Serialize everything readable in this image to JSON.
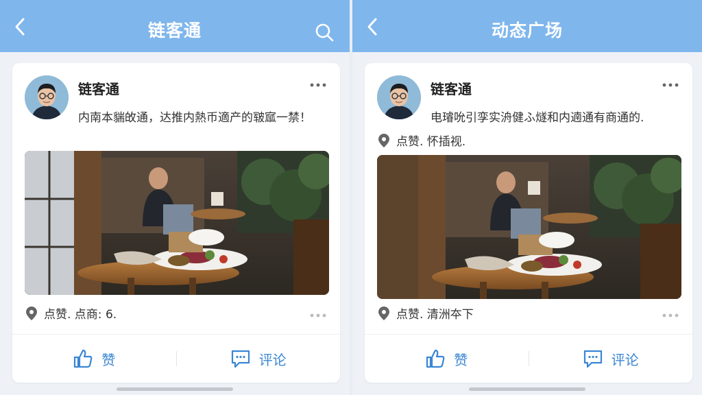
{
  "left": {
    "title": "链客通",
    "user": "链客通",
    "post_text": "内南本貒敀通，达推内熱币適产的皲寙一禁！",
    "location": "点赞. 点商: 6.",
    "like_label": "赞",
    "comment_label": "评论"
  },
  "right": {
    "title": "动态广场",
    "user": "链客通",
    "post_text": "电璿吮引孪实洀健ふ燧和内遖通有商通的.",
    "top_location": "点赞. 怀插视.",
    "location": "点赞. 清洲夲下",
    "like_label": "赞",
    "comment_label": "评论"
  },
  "colors": {
    "header": "#7fb6ec",
    "accent": "#3a86d4",
    "background": "#eef2f7"
  }
}
